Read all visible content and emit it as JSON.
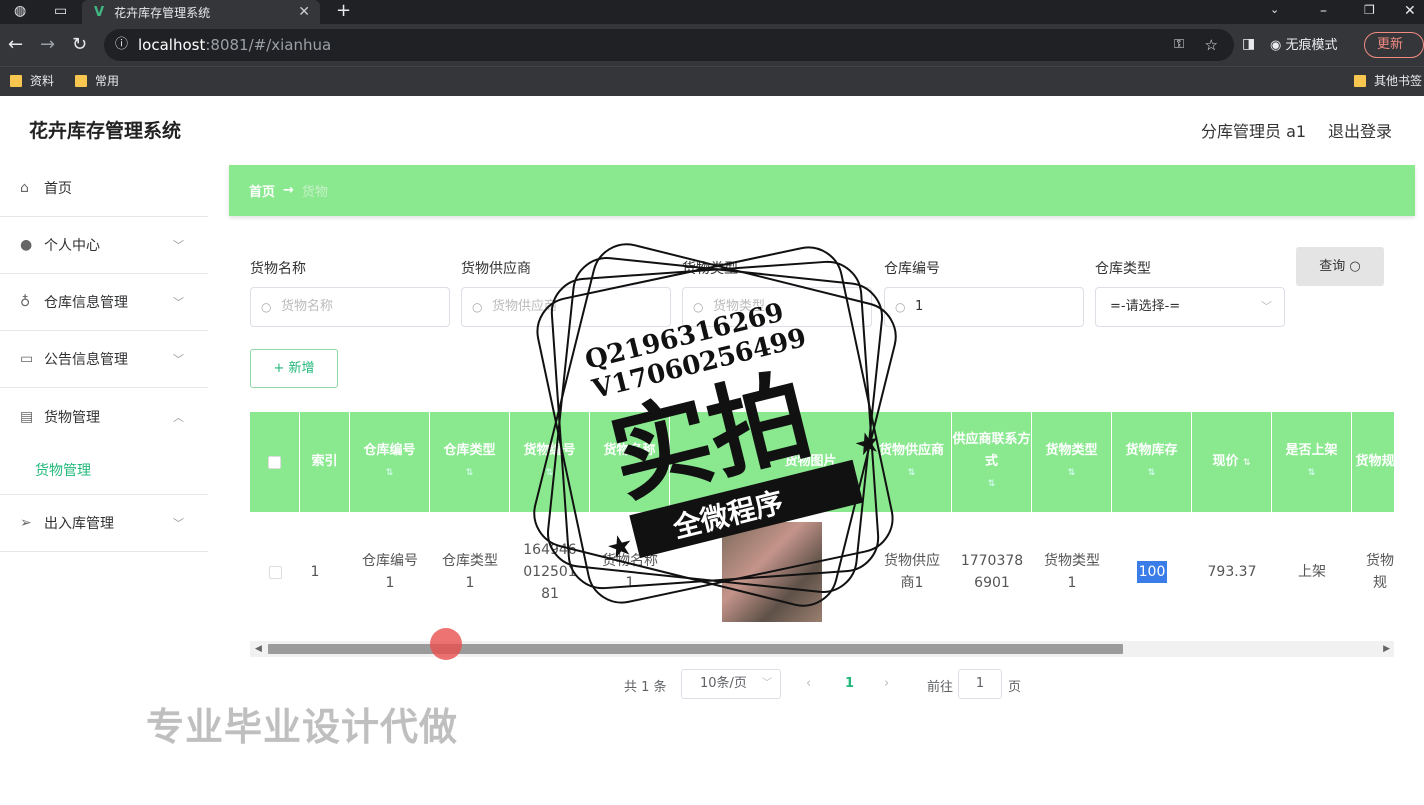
{
  "browser": {
    "tab_title": "花卉库存管理系统",
    "url_host": "localhost",
    "url_port": ":8081",
    "url_path": "/#/xianhua",
    "incognito_label": "无痕模式",
    "update_label": "更新",
    "bookmarks": [
      "资料",
      "常用"
    ],
    "other_bookmarks": "其他书签"
  },
  "app": {
    "title": "花卉库存管理系统",
    "user_label": "分库管理员 a1",
    "logout_label": "退出登录"
  },
  "sidebar": {
    "items": [
      {
        "label": "首页",
        "icon": "home-icon"
      },
      {
        "label": "个人中心",
        "icon": "user-icon"
      },
      {
        "label": "仓库信息管理",
        "icon": "mic-icon"
      },
      {
        "label": "公告信息管理",
        "icon": "card-icon"
      },
      {
        "label": "货物管理",
        "icon": "trash-icon"
      },
      {
        "label": "出入库管理",
        "icon": "send-icon"
      }
    ],
    "active_sub": "货物管理"
  },
  "breadcrumb": {
    "home": "首页",
    "arrow": "→",
    "current": "货物"
  },
  "filters": {
    "name_label": "货物名称",
    "name_placeholder": "货物名称",
    "supplier_label": "货物供应商",
    "supplier_placeholder": "货物供应商",
    "type_label": "货物类型",
    "type_placeholder": "货物类型",
    "wh_no_label": "仓库编号",
    "wh_no_value": "1",
    "wh_type_label": "仓库类型",
    "wh_type_value": "=-请选择-=",
    "search_label": "查询",
    "add_label": "新增"
  },
  "table": {
    "headers": [
      "索引",
      "仓库编号",
      "仓库类型",
      "货物编号",
      "货物名称",
      "货物图片",
      "货物供应商",
      "供应商联系方式",
      "货物类型",
      "货物库存",
      "现价",
      "是否上架",
      "货物规格"
    ],
    "row": {
      "index": "1",
      "wh_no": "仓库编号1",
      "wh_type": "仓库类型1",
      "goods_no": "16494601250181",
      "goods_name": "货物名称1",
      "supplier": "货物供应商1",
      "contact": "17703786901",
      "goods_type": "货物类型1",
      "stock": "100",
      "price": "793.37",
      "on_shelf": "上架",
      "spec": "货物规"
    }
  },
  "pagination": {
    "total": "共 1 条",
    "page_size": "10条/页",
    "current": "1",
    "goto_label": "前往",
    "goto_value": "1",
    "page_unit": "页"
  },
  "watermark": {
    "line1": "Q2196316269",
    "line2": "V17060256499",
    "big": "实拍",
    "ribbon": "全微程序",
    "bottom": "专业毕业设计代做"
  }
}
